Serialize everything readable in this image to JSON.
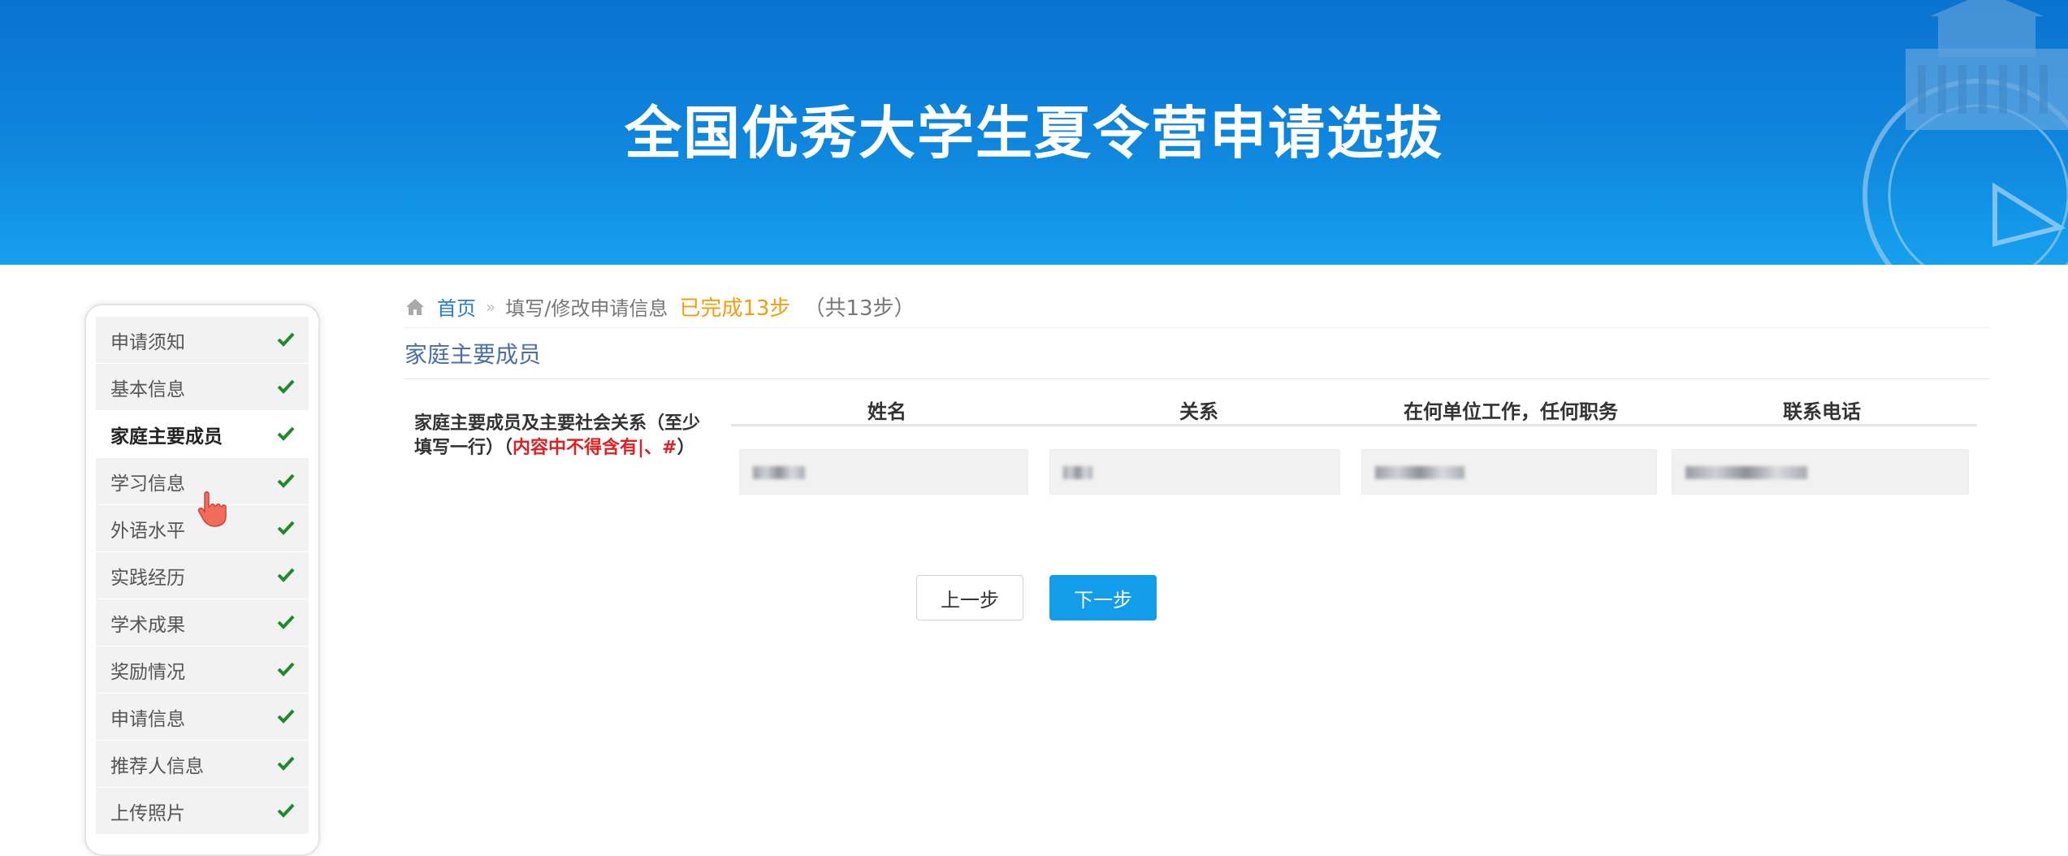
{
  "banner": {
    "title": "全国优秀大学生夏令营申请选拔"
  },
  "sidebar": {
    "items": [
      {
        "label": "申请须知",
        "done": true
      },
      {
        "label": "基本信息",
        "done": true
      },
      {
        "label": "家庭主要成员",
        "done": true,
        "active": true
      },
      {
        "label": "学习信息",
        "done": true
      },
      {
        "label": "外语水平",
        "done": true
      },
      {
        "label": "实践经历",
        "done": true
      },
      {
        "label": "学术成果",
        "done": true
      },
      {
        "label": "奖励情况",
        "done": true
      },
      {
        "label": "申请信息",
        "done": true
      },
      {
        "label": "推荐人信息",
        "done": true
      },
      {
        "label": "上传照片",
        "done": true
      }
    ],
    "check_color": "#1f8a2a"
  },
  "breadcrumb": {
    "home": "首页",
    "separator": "»",
    "page": "填写/修改申请信息",
    "done": "已完成13步",
    "total": "（共13步）"
  },
  "section": {
    "title": "家庭主要成员"
  },
  "form": {
    "label_main": "家庭主要成员及主要社会关系（至少填写一行）（",
    "label_warning": "内容中不得含有|、#",
    "label_end": "）",
    "columns": [
      "姓名",
      "关系",
      "在何单位工作，任何职务",
      "联系电话"
    ]
  },
  "buttons": {
    "prev": "上一步",
    "next": "下一步"
  },
  "colors": {
    "accent": "#139cea",
    "banner": "#0f86dd",
    "breadcrumb_done": "#f39c12",
    "warning": "#e02020"
  }
}
